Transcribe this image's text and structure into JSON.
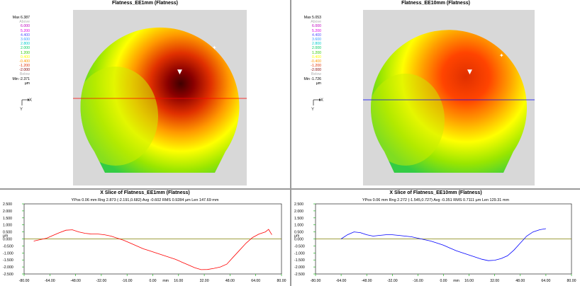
{
  "maps": [
    {
      "id": "left",
      "title": "Flatness_EE1mm (Flatness)",
      "legend": {
        "max": "Max 6.387",
        "above": "Above",
        "levels": [
          "6.000",
          "5.200",
          "4.400",
          "3.600",
          "2.800",
          "2.000",
          "1.200",
          "0.400",
          "-0.400",
          "-1.200",
          "-2.000"
        ],
        "below": "Below",
        "min": "Min -2.371",
        "unit": "µm",
        "colors": [
          "#c000c0",
          "#e000e0",
          "#5050ff",
          "#3399ff",
          "#00cccc",
          "#00cc66",
          "#33cc00",
          "#ffff00",
          "#ff9900",
          "#e03000",
          "#800000",
          "#c0c0c0"
        ]
      },
      "axis_x": "X",
      "axis_y": "Y",
      "slice_color": "#ff0000"
    },
    {
      "id": "right",
      "title": "Flatness_EE10mm (Flatness)",
      "legend": {
        "max": "Max 5.053",
        "above": "Above",
        "levels": [
          "6.000",
          "5.200",
          "4.400",
          "3.600",
          "2.800",
          "2.000",
          "1.200",
          "0.400",
          "-0.400",
          "-1.200",
          "-2.000"
        ],
        "below": "Below",
        "min": "Min -1.726",
        "unit": "µm",
        "colors": [
          "#c000c0",
          "#e000e0",
          "#5050ff",
          "#3399ff",
          "#00cccc",
          "#00cc66",
          "#33cc00",
          "#ffff00",
          "#ff9900",
          "#e03000",
          "#800000",
          "#c0c0c0"
        ]
      },
      "axis_x": "X",
      "axis_y": "Y",
      "slice_color": "#0000ff"
    }
  ],
  "chart_data": [
    {
      "type": "line",
      "title": "X Slice of Flatness_EE1mm (Flatness)",
      "stats": "YPos 0.06 mm Rng 2.873 (-2.191,0.682) Avg -0.602 RMS 0.9284 µm Len 147.69 mm",
      "ylabel": "µm",
      "xlabel": "mm",
      "xlim": [
        -80,
        80
      ],
      "ylim": [
        -2.5,
        2.5
      ],
      "yticks": [
        "2.500",
        "2.000",
        "1.500",
        "1.000",
        "0.500",
        "µm",
        "0.000",
        "-0.500",
        "-1.000",
        "-1.500",
        "-2.000",
        "-2.500"
      ],
      "xticks": [
        "-80.00",
        "-64.00",
        "-48.00",
        "-32.00",
        "-16.00",
        "0.00",
        "mm",
        "16.00",
        "32.00",
        "48.00",
        "64.00",
        "80.00"
      ],
      "line_color": "#ff0000",
      "series": [
        {
          "x": [
            -74,
            -70,
            -66,
            -62,
            -58,
            -54,
            -50,
            -46,
            -42,
            -38,
            -34,
            -30,
            -26,
            -22,
            -18,
            -14,
            -10,
            -6,
            -2,
            2,
            6,
            10,
            14,
            18,
            22,
            26,
            30,
            34,
            38,
            42,
            46,
            50,
            54,
            58,
            62,
            66,
            70,
            72,
            74
          ],
          "y": [
            -0.15,
            -0.05,
            0.05,
            0.25,
            0.45,
            0.62,
            0.65,
            0.5,
            0.4,
            0.35,
            0.35,
            0.3,
            0.2,
            0.05,
            -0.1,
            -0.3,
            -0.5,
            -0.7,
            -0.85,
            -1.0,
            -1.15,
            -1.3,
            -1.45,
            -1.65,
            -1.85,
            -2.05,
            -2.19,
            -2.18,
            -2.1,
            -2.0,
            -1.8,
            -1.3,
            -0.8,
            -0.3,
            0.1,
            0.35,
            0.5,
            0.68,
            0.3
          ]
        }
      ]
    },
    {
      "type": "line",
      "title": "X Slice of Flatness_EE10mm (Flatness)",
      "stats": "YPos 0.06 mm Rng 2.272 (-1.545,0.727) Avg -0.351 RMS 0.7111 µm Len 129.31 mm",
      "ylabel": "µm",
      "xlabel": "mm",
      "xlim": [
        -80,
        80
      ],
      "ylim": [
        -2.5,
        2.5
      ],
      "yticks": [
        "2.500",
        "2.000",
        "1.500",
        "1.000",
        "0.500",
        "µm",
        "0.000",
        "-0.500",
        "-1.000",
        "-1.500",
        "-2.000",
        "-2.500"
      ],
      "xticks": [
        "-80.00",
        "-64.00",
        "-48.00",
        "-32.00",
        "-16.00",
        "0.00",
        "mm",
        "16.00",
        "32.00",
        "48.00",
        "64.00",
        "80.00"
      ],
      "line_color": "#0000ff",
      "series": [
        {
          "x": [
            -64,
            -60,
            -56,
            -52,
            -48,
            -44,
            -40,
            -36,
            -32,
            -28,
            -24,
            -20,
            -16,
            -12,
            -8,
            -4,
            0,
            4,
            8,
            12,
            16,
            20,
            24,
            28,
            32,
            36,
            40,
            44,
            48,
            52,
            56,
            60,
            64
          ],
          "y": [
            0.0,
            0.3,
            0.5,
            0.45,
            0.3,
            0.2,
            0.25,
            0.3,
            0.3,
            0.25,
            0.2,
            0.15,
            0.05,
            -0.05,
            -0.15,
            -0.3,
            -0.45,
            -0.65,
            -0.85,
            -1.0,
            -1.15,
            -1.3,
            -1.45,
            -1.55,
            -1.52,
            -1.4,
            -1.2,
            -0.8,
            -0.3,
            0.2,
            0.5,
            0.65,
            0.73
          ]
        }
      ]
    }
  ]
}
